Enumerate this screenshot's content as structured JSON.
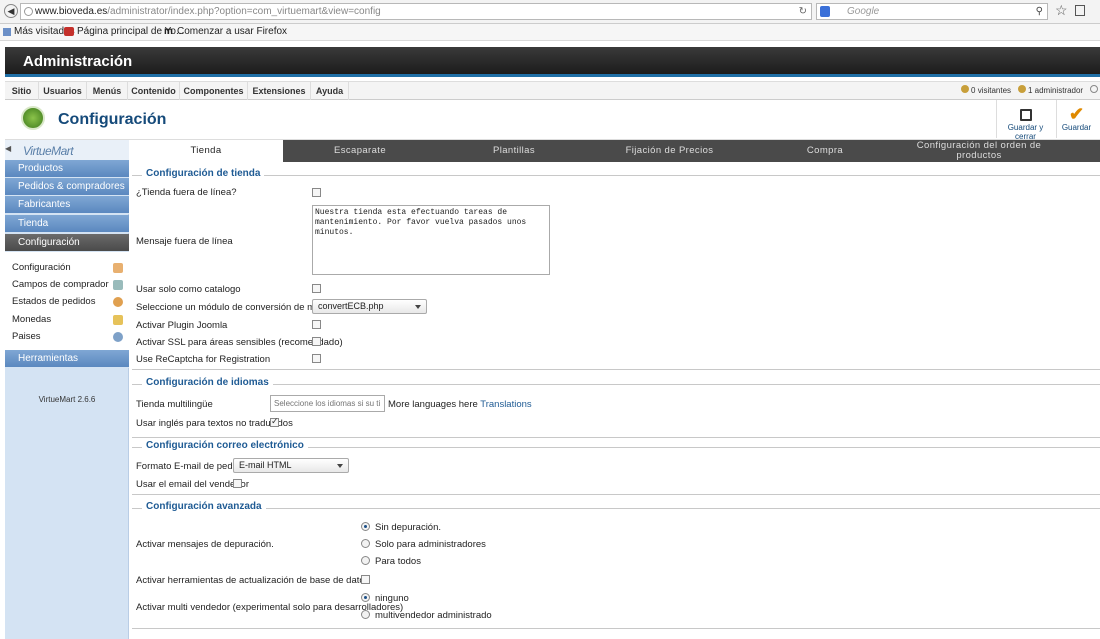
{
  "browser": {
    "url_domain": "www.bioveda.es",
    "url_path": "/administrator/index.php?option=com_virtuemart&view=config",
    "search_placeholder": "Google",
    "bookmarks": [
      "Más visitados",
      "Página principal de Yo...",
      "Comenzar a usar Firefox"
    ]
  },
  "admin": {
    "title": "Administración",
    "menu": [
      "Sitio",
      "Usuarios",
      "Menús",
      "Contenido",
      "Componentes",
      "Extensiones",
      "Ayuda"
    ],
    "visitors": "0 visitantes",
    "admins": "1 administrador"
  },
  "page": {
    "title": "Configuración",
    "save_close_label": "Guardar y cerrar",
    "save_label": "Guardar"
  },
  "sidebar": {
    "logo": "VirtueMart",
    "sections": [
      "Productos",
      "Pedidos & compradores",
      "Fabricantes",
      "Tienda",
      "Configuración"
    ],
    "sub_items": [
      "Configuración",
      "Campos de comprador",
      "Estados de pedidos",
      "Monedas",
      "Paises"
    ],
    "tools": "Herramientas",
    "version": "VirtueMart 2.6.6"
  },
  "tabs": [
    "Tienda",
    "Escaparate",
    "Plantillas",
    "Fijación de Precios",
    "Compra",
    "Configuración del orden de productos"
  ],
  "store_config": {
    "legend": "Configuración de tienda",
    "offline_label": "¿Tienda fuera de línea?",
    "offline_message_label": "Mensaje fuera de línea",
    "offline_message": "Nuestra tienda esta efectuando tareas de mantenimiento. Por favor vuelva pasados unos minutos.",
    "catalog_label": "Usar solo como catalogo",
    "currency_module_label": "Seleccione un módulo de conversión de moneda",
    "currency_module_value": "convertECB.php",
    "joomla_plugin_label": "Activar Plugin Joomla",
    "ssl_label": "Activar SSL para áreas sensibles (recomendado)",
    "recaptcha_label": "Use ReCaptcha for Registration"
  },
  "language_config": {
    "legend": "Configuración de idiomas",
    "multilingual_label": "Tienda multilingüe",
    "multilingual_placeholder": "Seleccione los idiomas si su ti",
    "more_languages": "More languages here",
    "translations_link": "Translations",
    "english_fallback_label": "Usar inglés para textos no traducidos"
  },
  "email_config": {
    "legend": "Configuración correo electrónico",
    "format_label": "Formato E-mail de pedido",
    "format_value": "E-mail HTML",
    "vendor_email_label": "Usar el email del vendedor"
  },
  "advanced_config": {
    "legend": "Configuración avanzada",
    "debug_label": "Activar mensajes de depuración.",
    "debug_options": [
      "Sin depuración.",
      "Solo para administradores",
      "Para todos"
    ],
    "db_tools_label": "Activar herramientas de actualización de base de datos",
    "multivendor_label": "Activar multi vendedor (experimental solo para desarrolladores)",
    "multivendor_options": [
      "ninguno",
      "multivendedor administrado"
    ]
  }
}
